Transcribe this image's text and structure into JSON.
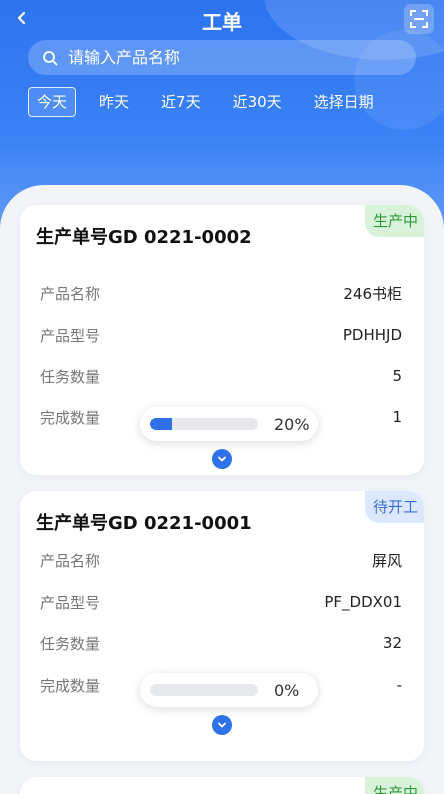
{
  "header": {
    "title": "工单"
  },
  "search": {
    "placeholder": "请输入产品名称"
  },
  "tabs": [
    {
      "label": "今天",
      "active": true
    },
    {
      "label": "昨天",
      "active": false
    },
    {
      "label": "近7天",
      "active": false
    },
    {
      "label": "近30天",
      "active": false
    },
    {
      "label": "选择日期",
      "active": false
    }
  ],
  "labels": {
    "product_name": "产品名称",
    "product_model": "产品型号",
    "task_qty": "任务数量",
    "done_qty": "完成数量"
  },
  "orders": [
    {
      "title": "生产单号GD 0221-0002",
      "status": "生产中",
      "product_name": "246书柜",
      "product_model": "PDHHJD",
      "task_qty": "5",
      "done_qty": "1",
      "progress": 0.2,
      "progress_text": "20%"
    },
    {
      "title": "生产单号GD 0221-0001",
      "status": "待开工",
      "product_name": "屏风",
      "product_model": "PF_DDX01",
      "task_qty": "32",
      "done_qty": "-",
      "progress": 0,
      "progress_text": "0%"
    },
    {
      "status": "生产中"
    }
  ],
  "colors": {
    "primary": "#2f6fe8",
    "status_producing_bg": "#d9f3da",
    "status_producing_fg": "#2f9a3c",
    "status_pending_bg": "#dce8fd",
    "status_pending_fg": "#3b6fd6"
  }
}
